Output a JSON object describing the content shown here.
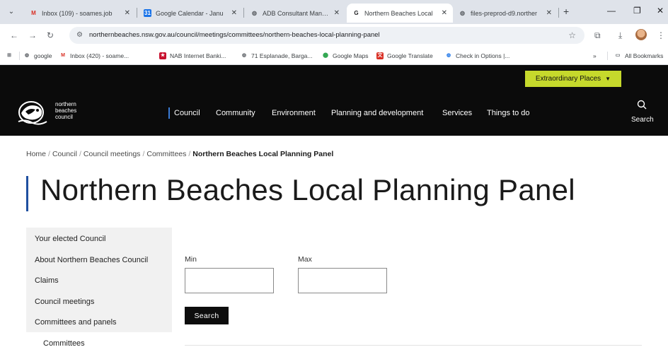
{
  "browser": {
    "tabs": [
      {
        "title": "Inbox (109) - soames.job",
        "favicon": "gmail-icon",
        "active": false
      },
      {
        "title": "Google Calendar - Janu",
        "favicon": "calendar-icon",
        "active": false
      },
      {
        "title": "ADB Consultant Manage",
        "favicon": "globe-icon",
        "active": false
      },
      {
        "title": "Northern Beaches Local",
        "favicon": "nbc-icon",
        "active": true
      },
      {
        "title": "files-preprod-d9.norther",
        "favicon": "globe-icon",
        "active": false
      }
    ],
    "url": "northernbeaches.nsw.gov.au/council/meetings/committees/northern-beaches-local-planning-panel",
    "bookmarks": [
      {
        "label": "google",
        "icon": "globe-icon"
      },
      {
        "label": "Inbox (420) - soame...",
        "icon": "gmail-icon"
      },
      {
        "label": "NAB Internet Banki...",
        "icon": "nab-icon"
      },
      {
        "label": "71 Esplanade, Barga...",
        "icon": "globe-icon"
      },
      {
        "label": "Google Maps",
        "icon": "maps-icon"
      },
      {
        "label": "Google Translate",
        "icon": "translate-icon"
      },
      {
        "label": "Check in Options |...",
        "icon": "globe-icon"
      }
    ],
    "all_bookmarks_label": "All Bookmarks",
    "overflow_label": "»"
  },
  "header": {
    "extraordinary_label": "Extraordinary Places",
    "logo_lines": [
      "northern",
      "beaches",
      "council"
    ],
    "nav": [
      "Council",
      "Community",
      "Environment",
      "Planning and development",
      "Services",
      "Things to do"
    ],
    "search_label": "Search"
  },
  "breadcrumb": {
    "items": [
      "Home",
      "Council",
      "Council meetings",
      "Committees"
    ],
    "current": "Northern Beaches Local Planning Panel",
    "separator": "/"
  },
  "page": {
    "title": "Northern Beaches Local Planning Panel"
  },
  "sidebar": {
    "items": [
      "Your elected Council",
      "About Northern Beaches Council",
      "Claims",
      "Council meetings",
      "Committees and panels"
    ],
    "subitem": "Committees"
  },
  "filter": {
    "min_label": "Min",
    "max_label": "Max",
    "min_value": "",
    "max_value": "",
    "search_button": "Search"
  },
  "colors": {
    "header_bg": "#0b0b0b",
    "accent_green": "#c6d92c",
    "title_bar_blue": "#1f4fa0",
    "sidebar_bg": "#f1f1f1"
  }
}
